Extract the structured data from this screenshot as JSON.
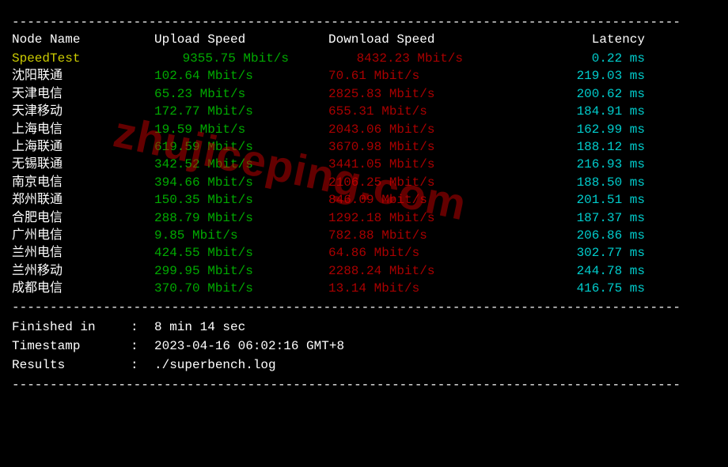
{
  "headers": {
    "name": "Node Name",
    "upload": "Upload Speed",
    "download": "Download Speed",
    "latency": "Latency"
  },
  "speedtest_row": {
    "name": "SpeedTest",
    "upload": "9355.75 Mbit/s",
    "download": "8432.23 Mbit/s",
    "latency": "0.22 ms"
  },
  "rows": [
    {
      "name": "沈阳联通",
      "upload": "102.64 Mbit/s",
      "download": "70.61 Mbit/s",
      "latency": "219.03 ms"
    },
    {
      "name": "天津电信",
      "upload": "65.23 Mbit/s",
      "download": "2825.83 Mbit/s",
      "latency": "200.62 ms"
    },
    {
      "name": "天津移动",
      "upload": "172.77 Mbit/s",
      "download": "655.31 Mbit/s",
      "latency": "184.91 ms"
    },
    {
      "name": "上海电信",
      "upload": "19.59 Mbit/s",
      "download": "2043.06 Mbit/s",
      "latency": "162.99 ms"
    },
    {
      "name": "上海联通",
      "upload": "619.59 Mbit/s",
      "download": "3670.98 Mbit/s",
      "latency": "188.12 ms"
    },
    {
      "name": "无锡联通",
      "upload": "342.52 Mbit/s",
      "download": "3441.05 Mbit/s",
      "latency": "216.93 ms"
    },
    {
      "name": "南京电信",
      "upload": "394.66 Mbit/s",
      "download": "2106.25 Mbit/s",
      "latency": "188.50 ms"
    },
    {
      "name": "郑州联通",
      "upload": "150.35 Mbit/s",
      "download": "846.09 Mbit/s",
      "latency": "201.51 ms"
    },
    {
      "name": "合肥电信",
      "upload": "288.79 Mbit/s",
      "download": "1292.18 Mbit/s",
      "latency": "187.37 ms"
    },
    {
      "name": "广州电信",
      "upload": "9.85 Mbit/s",
      "download": "782.88 Mbit/s",
      "latency": "206.86 ms"
    },
    {
      "name": "兰州电信",
      "upload": "424.55 Mbit/s",
      "download": "64.86 Mbit/s",
      "latency": "302.77 ms"
    },
    {
      "name": "兰州移动",
      "upload": "299.95 Mbit/s",
      "download": "2288.24 Mbit/s",
      "latency": "244.78 ms"
    },
    {
      "name": "成都电信",
      "upload": "370.70 Mbit/s",
      "download": "13.14 Mbit/s",
      "latency": "416.75 ms"
    }
  ],
  "summary": {
    "finished_label": "Finished in",
    "finished_value": "8 min 14 sec",
    "timestamp_label": "Timestamp",
    "timestamp_value": "2023-04-16 06:02:16 GMT+8",
    "results_label": "Results",
    "results_value": "./superbench.log",
    "separator": ":"
  },
  "divider": "----------------------------------------------------------------------------------------",
  "watermark": "zhujiceping.com"
}
